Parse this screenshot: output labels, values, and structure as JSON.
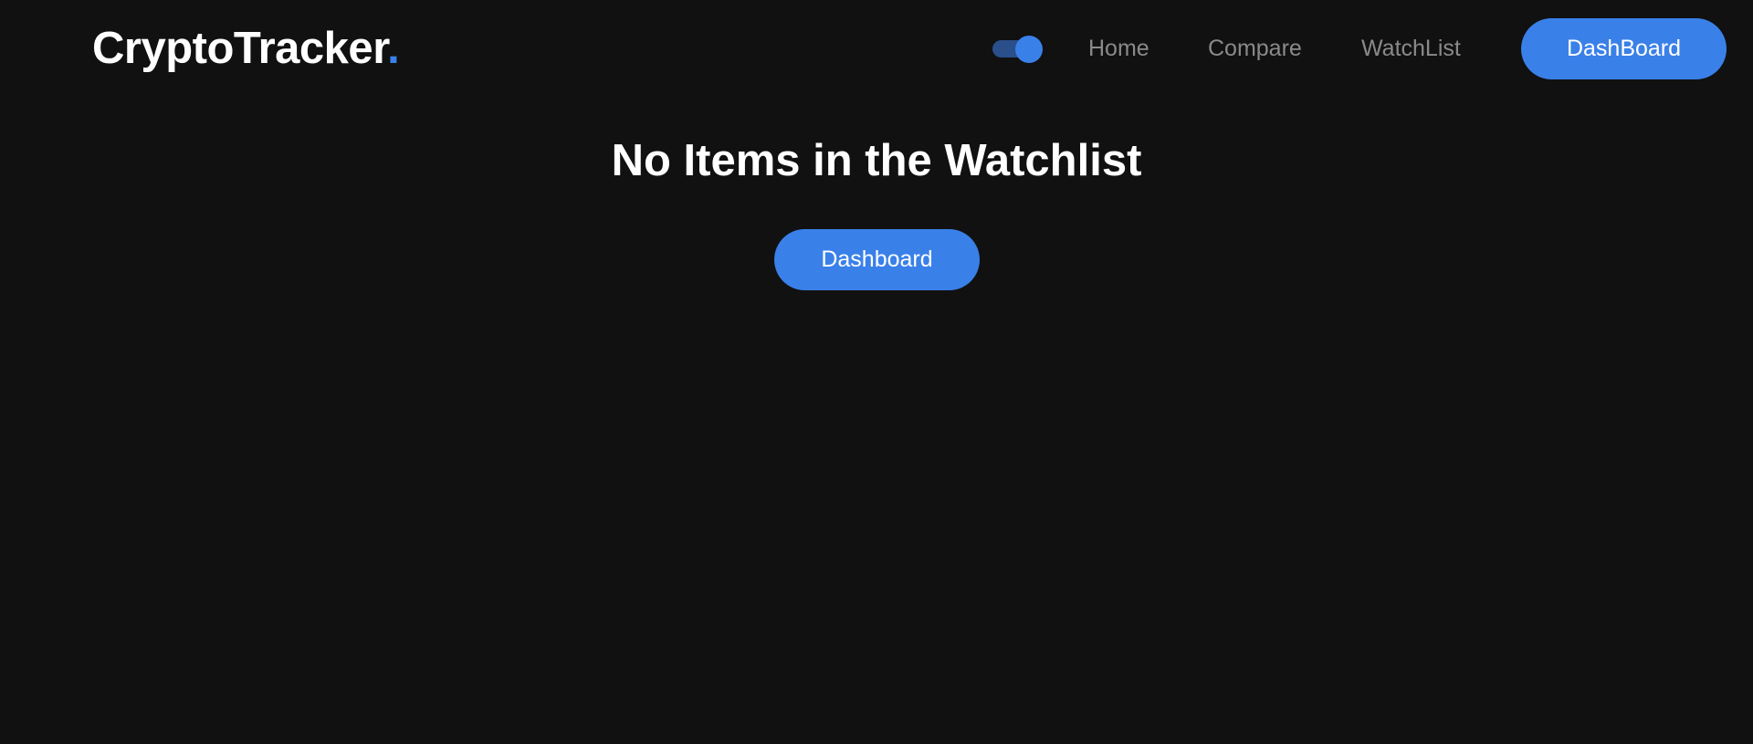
{
  "header": {
    "logo_text": "CryptoTracker",
    "logo_dot": ".",
    "theme_toggle_on": true,
    "nav": {
      "home": "Home",
      "compare": "Compare",
      "watchlist": "WatchList"
    },
    "dashboard_button": "DashBoard"
  },
  "main": {
    "empty_message": "No Items in the Watchlist",
    "dashboard_button": "Dashboard"
  },
  "colors": {
    "background": "#111111",
    "accent": "#3a80e9",
    "text": "#ffffff",
    "nav_text": "#8a8a8a"
  }
}
